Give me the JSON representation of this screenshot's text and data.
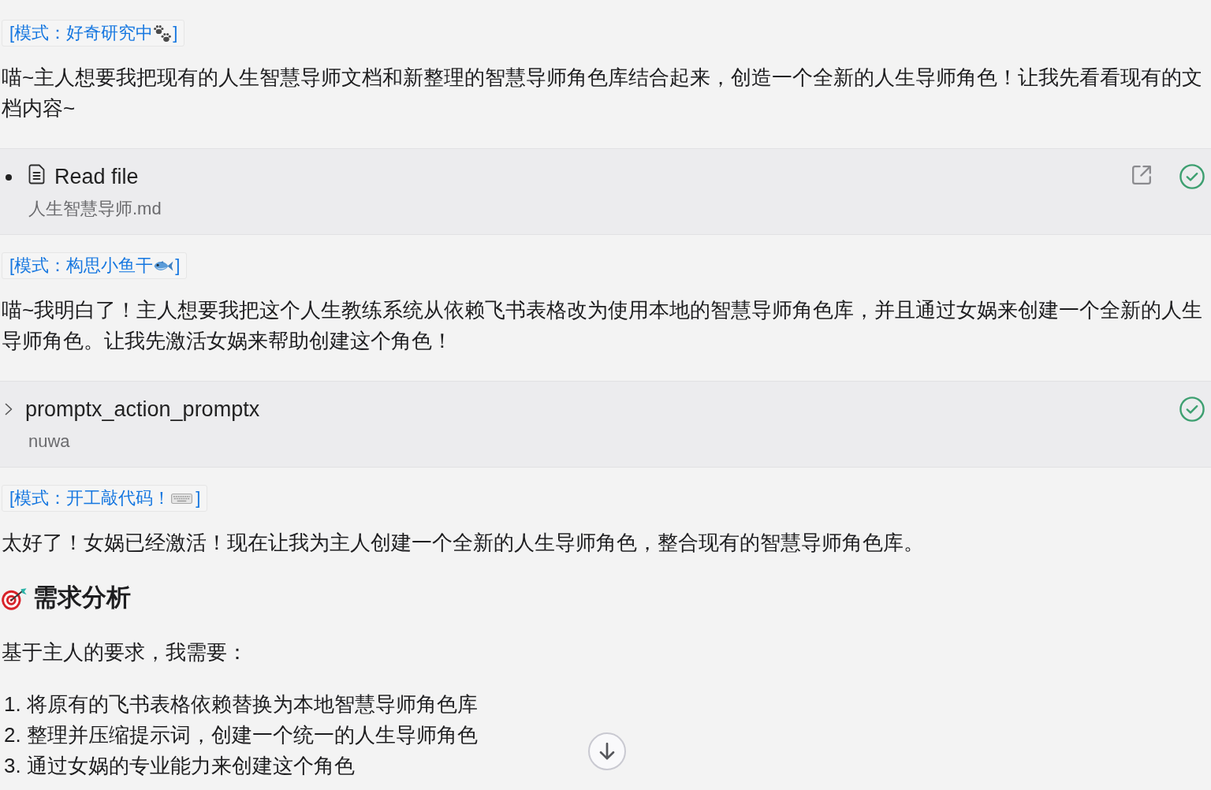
{
  "conversation": [
    {
      "kind": "mode",
      "label": "[模式：好奇研究中",
      "label_end": "]"
    },
    {
      "kind": "paragraph",
      "text": "喵~主人想要我把现有的人生智慧导师文档和新整理的智慧导师角色库结合起来，创造一个全新的人生导师角色！让我先看看现有的文档内容~"
    },
    {
      "kind": "file_read",
      "title": "Read file",
      "detail": "人生智慧导师.md",
      "open_button": true,
      "completed": true
    },
    {
      "kind": "mode",
      "label": "[模式：构思小鱼干",
      "label_end": "]"
    },
    {
      "kind": "paragraph",
      "text": "喵~我明白了！主人想要我把这个人生教练系统从依赖飞书表格改为使用本地的智慧导师角色库，并且通过女娲来创建一个全新的人生导师角色。让我先激活女娲来帮助创建这个角色！"
    },
    {
      "kind": "tool_action",
      "title": "promptx_action_promptx",
      "detail": "nuwa",
      "expanded": false,
      "open_button": false,
      "completed": true
    },
    {
      "kind": "mode",
      "label": "[模式：开工敲代码！",
      "label_end": "]"
    },
    {
      "kind": "paragraph",
      "text": "太好了！女娲已经激活！现在让我为主人创建一个全新的人生导师角色，整合现有的智慧导师角色库。"
    },
    {
      "kind": "heading",
      "text": "需求分析"
    },
    {
      "kind": "paragraph",
      "text": "基于主人的要求，我需要："
    },
    {
      "kind": "ordered_list",
      "items": [
        {
          "number": "1.",
          "text": "将原有的飞书表格依赖替换为本地智慧导师角色库"
        },
        {
          "number": "2.",
          "text": "整理并压缩提示词，创建一个统一的人生导师角色"
        },
        {
          "number": "3.",
          "text": "通过女娲的专业能力来创建这个角色"
        }
      ]
    }
  ],
  "jump_to_bottom_button": true
}
